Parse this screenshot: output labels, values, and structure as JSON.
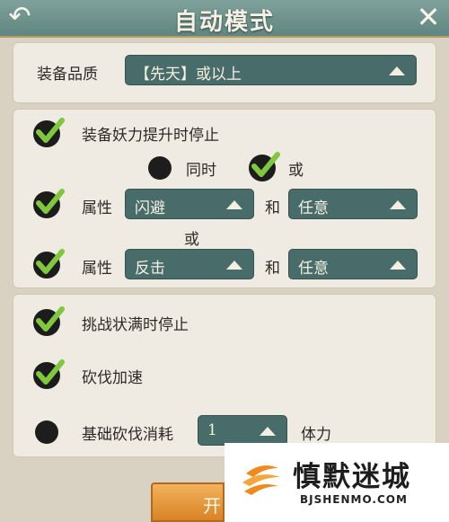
{
  "header": {
    "title": "自动模式",
    "back_icon": "back-arrow-icon",
    "close_icon": "close-x-icon"
  },
  "quality": {
    "label": "装备品质",
    "value": "【先天】或以上"
  },
  "stop_on_power": {
    "label": "装备妖力提升时停止",
    "checked": true,
    "mode_and_label": "同时",
    "mode_and_selected": false,
    "mode_or_label": "或",
    "mode_or_selected": true
  },
  "attr_row1": {
    "checked": true,
    "label": "属性",
    "value1": "闪避",
    "joiner": "和",
    "value2": "任意"
  },
  "row_or": "或",
  "attr_row2": {
    "checked": true,
    "label": "属性",
    "value1": "反击",
    "joiner": "和",
    "value2": "任意"
  },
  "stop_on_full": {
    "label": "挑战状满时停止",
    "checked": true
  },
  "speed_up": {
    "label": "砍伐加速",
    "checked": true
  },
  "base_cost": {
    "label": "基础砍伐消耗",
    "selected": false,
    "value": "1",
    "unit": "体力"
  },
  "start_button": {
    "label": "开"
  },
  "watermark": {
    "title": "慎默迷城",
    "subtitle": "BJSHENMO.COM",
    "colors": {
      "flame": "#f08a1c",
      "text": "#1d1d1d"
    }
  }
}
